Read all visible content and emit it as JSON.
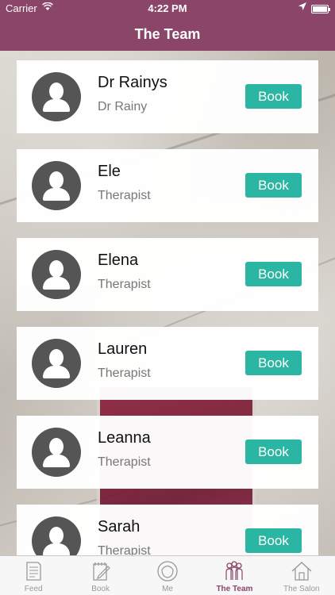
{
  "status_bar": {
    "carrier": "Carrier",
    "time": "4:22 PM"
  },
  "nav": {
    "title": "The Team"
  },
  "team": [
    {
      "name": "Dr Rainys",
      "role": "Dr Rainy",
      "button": "Book"
    },
    {
      "name": "Ele",
      "role": "Therapist",
      "button": "Book"
    },
    {
      "name": "Elena",
      "role": "Therapist",
      "button": "Book"
    },
    {
      "name": "Lauren",
      "role": "Therapist",
      "button": "Book"
    },
    {
      "name": "Leanna",
      "role": "Therapist",
      "button": "Book"
    },
    {
      "name": "Sarah",
      "role": "Therapist",
      "button": "Book"
    }
  ],
  "tabs": [
    {
      "label": "Feed",
      "icon": "document-icon",
      "active": false
    },
    {
      "label": "Book",
      "icon": "edit-notebook-icon",
      "active": false
    },
    {
      "label": "Me",
      "icon": "person-icon",
      "active": false
    },
    {
      "label": "The Team",
      "icon": "team-icon",
      "active": true
    },
    {
      "label": "The Salon",
      "icon": "house-icon",
      "active": false
    }
  ],
  "colors": {
    "brand": "#8b4568",
    "book_button": "#2bb5a3",
    "avatar": "#555555"
  }
}
